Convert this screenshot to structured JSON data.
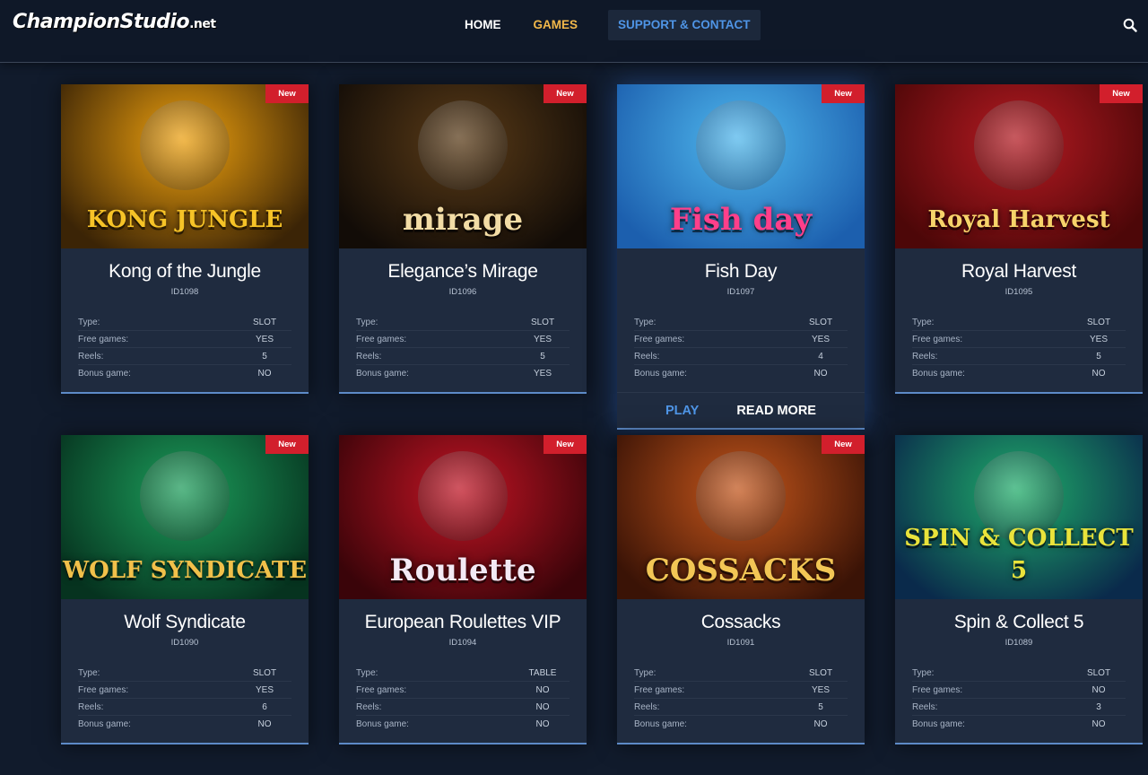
{
  "header": {
    "logo_main": "ChampionStudio",
    "logo_suffix": ".net",
    "nav": {
      "home": "HOME",
      "games": "GAMES",
      "support": "SUPPORT & CONTACT"
    },
    "search_icon": "search-icon"
  },
  "spec_labels": {
    "type": "Type:",
    "free_games": "Free games:",
    "reels": "Reels:",
    "bonus_game": "Bonus game:"
  },
  "badge_label": "New",
  "actions": {
    "play": "PLAY",
    "read_more": "READ MORE"
  },
  "games": [
    {
      "title": "Kong of the Jungle",
      "id": "ID1098",
      "type": "SLOT",
      "free_games": "YES",
      "reels": "5",
      "bonus_game": "NO",
      "is_new": true,
      "art_text": "KONG JUNGLE",
      "art_color": "#f6c327",
      "bg_from": "#f0a20e",
      "bg_to": "#3b2406"
    },
    {
      "title": "Elegance’s Mirage",
      "id": "ID1096",
      "type": "SLOT",
      "free_games": "YES",
      "reels": "5",
      "bonus_game": "YES",
      "is_new": true,
      "art_text": "mirage",
      "art_color": "#f2dca5",
      "bg_from": "#5a3b17",
      "bg_to": "#120c07"
    },
    {
      "title": "Fish Day",
      "id": "ID1097",
      "type": "SLOT",
      "free_games": "YES",
      "reels": "4",
      "bonus_game": "NO",
      "is_new": true,
      "art_text": "Fish day",
      "art_color": "#ff3f8a",
      "bg_from": "#4fb8ee",
      "bg_to": "#1c5fae"
    },
    {
      "title": "Royal Harvest",
      "id": "ID1095",
      "type": "SLOT",
      "free_games": "YES",
      "reels": "5",
      "bonus_game": "NO",
      "is_new": true,
      "art_text": "Royal Harvest",
      "art_color": "#f7d36a",
      "bg_from": "#b51a22",
      "bg_to": "#4d0708"
    },
    {
      "title": "Wolf Syndicate",
      "id": "ID1090",
      "type": "SLOT",
      "free_games": "YES",
      "reels": "6",
      "bonus_game": "NO",
      "is_new": true,
      "art_text": "WOLF SYNDICATE",
      "art_color": "#f1c04a",
      "bg_from": "#1c9e5b",
      "bg_to": "#06331f"
    },
    {
      "title": "European Roulettes VIP",
      "id": "ID1094",
      "type": "TABLE",
      "free_games": "NO",
      "reels": "NO",
      "bonus_game": "NO",
      "is_new": true,
      "art_text": "Roulette",
      "art_color": "#f3eaf5",
      "bg_from": "#c21424",
      "bg_to": "#3a0409"
    },
    {
      "title": "Cossacks",
      "id": "ID1091",
      "type": "SLOT",
      "free_games": "YES",
      "reels": "5",
      "bonus_game": "NO",
      "is_new": true,
      "art_text": "COSSACKS",
      "art_color": "#f2c655",
      "bg_from": "#c5561b",
      "bg_to": "#3a1306"
    },
    {
      "title": "Spin & Collect 5",
      "id": "ID1089",
      "type": "SLOT",
      "free_games": "NO",
      "reels": "3",
      "bonus_game": "NO",
      "is_new": false,
      "art_text": "SPIN & COLLECT 5",
      "art_color": "#e9e33b",
      "bg_from": "#1fae6a",
      "bg_to": "#0a2a4b"
    }
  ]
}
